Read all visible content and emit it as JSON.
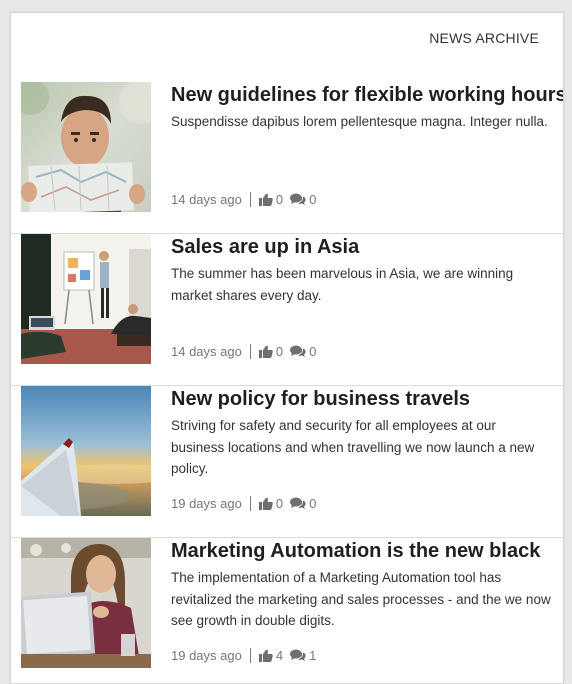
{
  "header": {
    "archive_label": "NEWS ARCHIVE"
  },
  "colors": {
    "meta_text": "#777777",
    "icon": "#6e6e6e",
    "title": "#1f1f1f"
  },
  "items": [
    {
      "title": "New guidelines for flexible working hours",
      "summary": "Suspendisse dapibus lorem pellentesque magna. Integer nulla.",
      "age": "14 days ago",
      "likes": "0",
      "comments": "0",
      "image": "man-reading-map-photo"
    },
    {
      "title": "Sales are up in Asia",
      "summary": "The summer has been marvelous in Asia, we are winning market shares every day.",
      "age": "14 days ago",
      "likes": "0",
      "comments": "0",
      "image": "office-presentation-photo"
    },
    {
      "title": "New policy for business travels",
      "summary": "Striving for safety and security for all employees at our business locations and when travelling we now launch a new policy.",
      "age": "19 days ago",
      "likes": "0",
      "comments": "0",
      "image": "airplane-wing-photo"
    },
    {
      "title": "Marketing Automation is the new black",
      "summary": "The implementation of a Marketing Automation tool has revitalized the marketing and sales processes - and the we now see growth in double digits.",
      "age": "19 days ago",
      "likes": "4",
      "comments": "1",
      "image": "woman-with-laptop-photo"
    }
  ]
}
